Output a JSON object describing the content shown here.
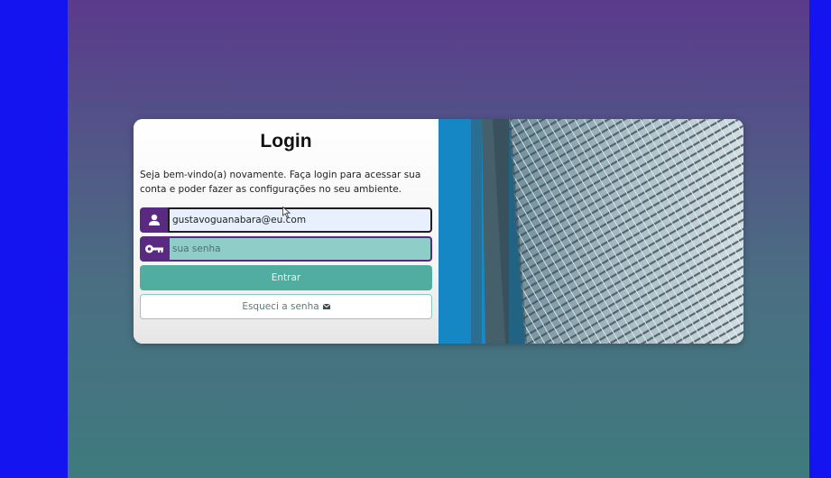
{
  "login": {
    "title": "Login",
    "subtitle": "Seja bem-vindo(a) novamente. Faça login para acessar sua conta e poder fazer as configurações no seu ambiente.",
    "email": {
      "value": "gustavoguanabara@eu.com",
      "icon": "user-icon"
    },
    "password": {
      "placeholder": "sua senha",
      "icon": "key-icon"
    },
    "enter_label": "Entrar",
    "forgot_label": "Esqueci a senha",
    "forgot_icon": "envelope-icon"
  },
  "colors": {
    "outer_background": "#1414f0",
    "accent_purple": "#5a2a82",
    "button_teal": "#50ad9f"
  }
}
